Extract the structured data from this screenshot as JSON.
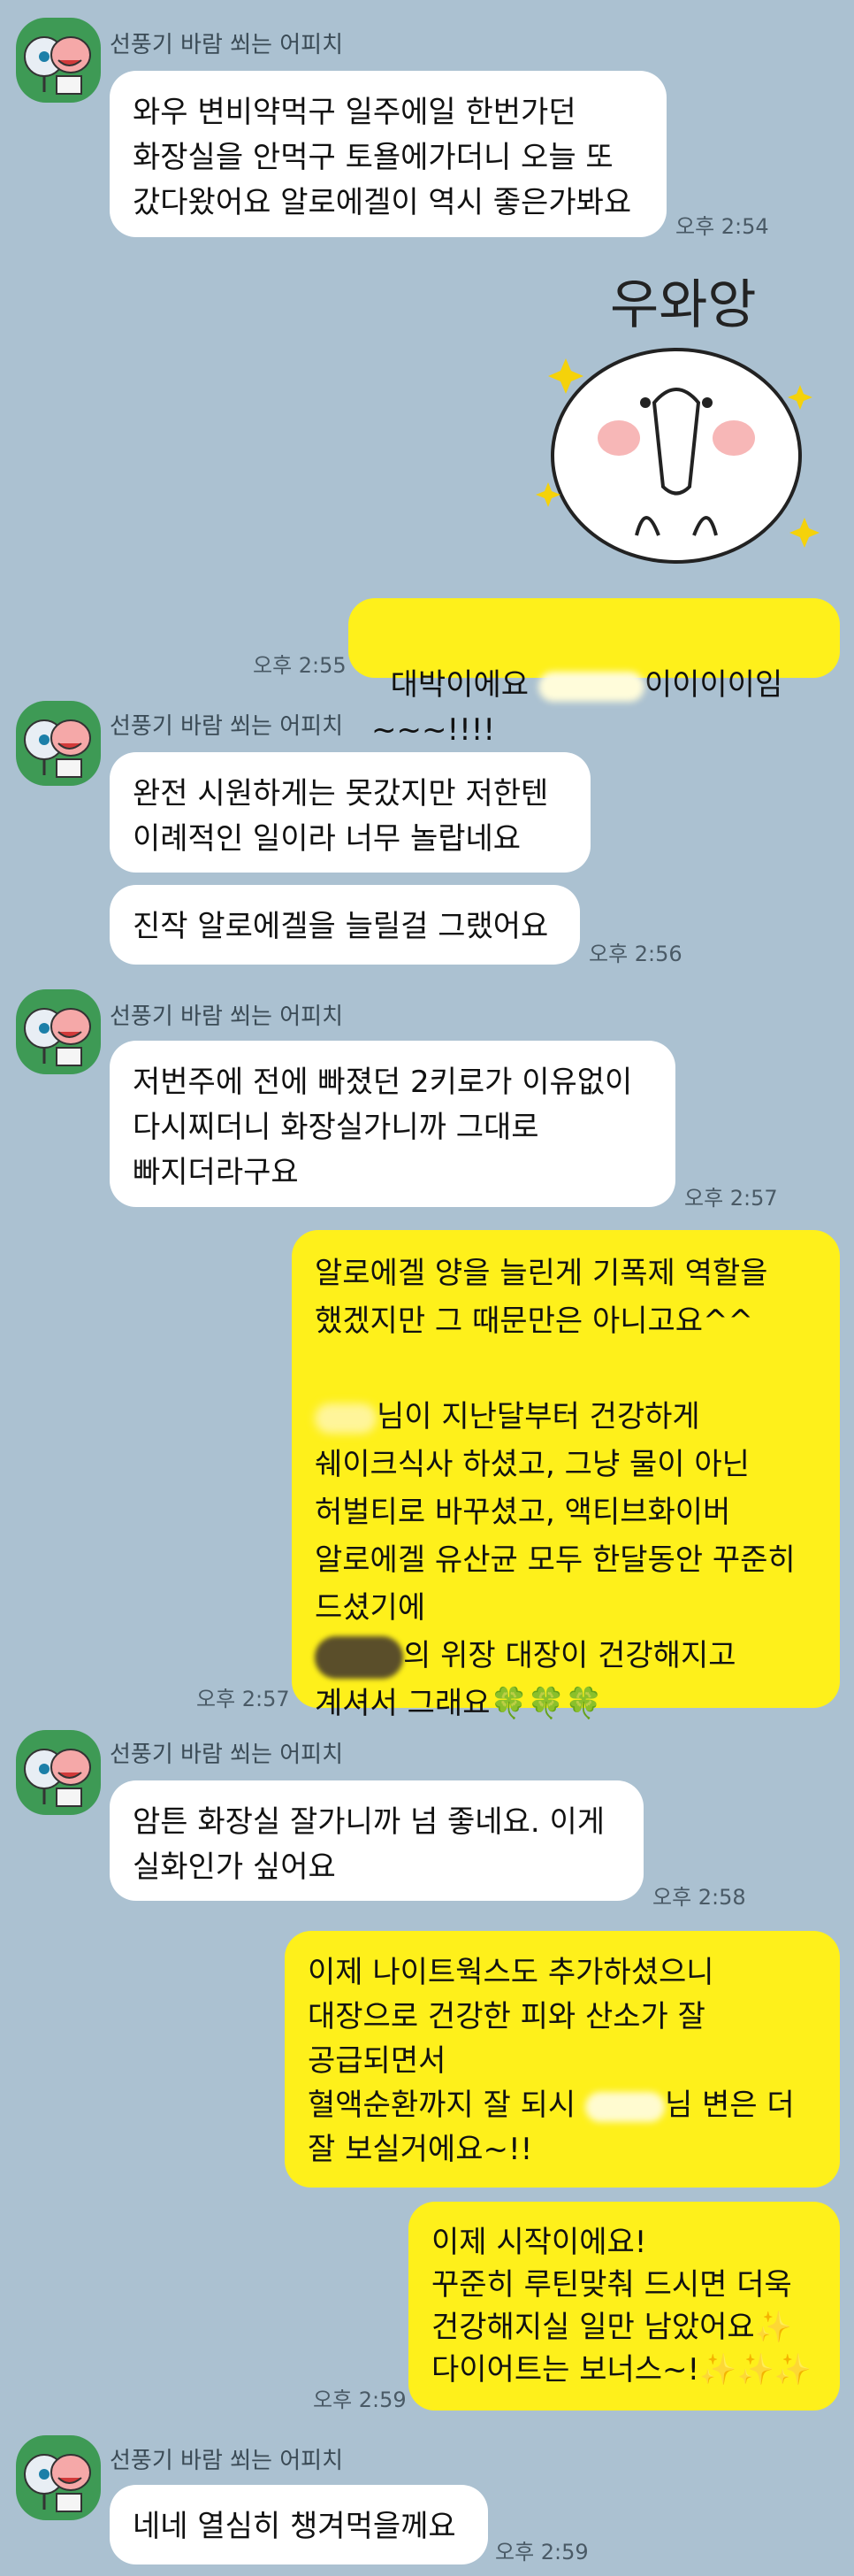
{
  "sender_name": "선풍기 바람 쐬는 어피치",
  "messages": {
    "m1": {
      "text": "와우 변비약먹구 일주에일 한번가던\n화장실을 안먹구 토욜에가더니 오늘 또\n갔다왔어요 알로에겔이 역시 좋은가봐요",
      "time": "오후 2:54"
    },
    "sticker": {
      "text": "우와앙"
    },
    "m2": {
      "text_a": "대박이에요 ",
      "text_b": "이이이이임~~~!!!!",
      "time": "오후 2:55"
    },
    "m3": {
      "text": "완전 시원하게는 못갔지만 저한텐\n이례적인 일이라 너무 놀랍네요"
    },
    "m4": {
      "text": "진작 알로에겔을 늘릴걸 그랬어요",
      "time": "오후 2:56"
    },
    "m5": {
      "text": "저번주에 전에 빠졌던 2키로가 이유없이\n다시찌더니 화장실가니까 그대로\n빠지더라구요",
      "time": "오후 2:57"
    },
    "m6": {
      "line1": "알로에겔 양을 늘린게 기폭제 역할을",
      "line2": "했겠지만 그 때문만은 아니고요^^",
      "line3": "님이 지난달부터 건강하게",
      "line4": "쉐이크식사 하셨고, 그냥 물이 아닌",
      "line5": "허벌티로 바꾸셨고, 액티브화이버",
      "line6": "알로에겔 유산균 모두 한달동안 꾸준히",
      "line7": "드셨기에",
      "line8": "의 위장 대장이 건강해지고",
      "line9": "계셔서 그래요",
      "clovers": "🍀🍀🍀",
      "time": "오후 2:57"
    },
    "m7": {
      "text": "암튼 화장실 잘가니까 넘 좋네요. 이게\n실화인가 싶어요",
      "time": "오후 2:58"
    },
    "m8": {
      "line1": "이제 나이트웍스도 추가하셨으니",
      "line2": "대장으로 건강한 피와 산소가 잘",
      "line3": "공급되면서",
      "line4a": "혈액순환까지 잘 되시",
      "line4b": "님 변은 더",
      "line5": "잘 보실거에요~!!"
    },
    "m9": {
      "line1": "이제 시작이에요!",
      "line2": "꾸준히 루틴맞춰 드시면 더욱",
      "line3": "건강해지실 일만 남았어요",
      "line4": "다이어트는 보너스~!",
      "sparkle1": "✨",
      "sparkles": "✨✨✨",
      "time": "오후 2:59"
    },
    "m10": {
      "text": "네네 열심히 챙겨먹을께요",
      "time": "오후 2:59"
    }
  }
}
